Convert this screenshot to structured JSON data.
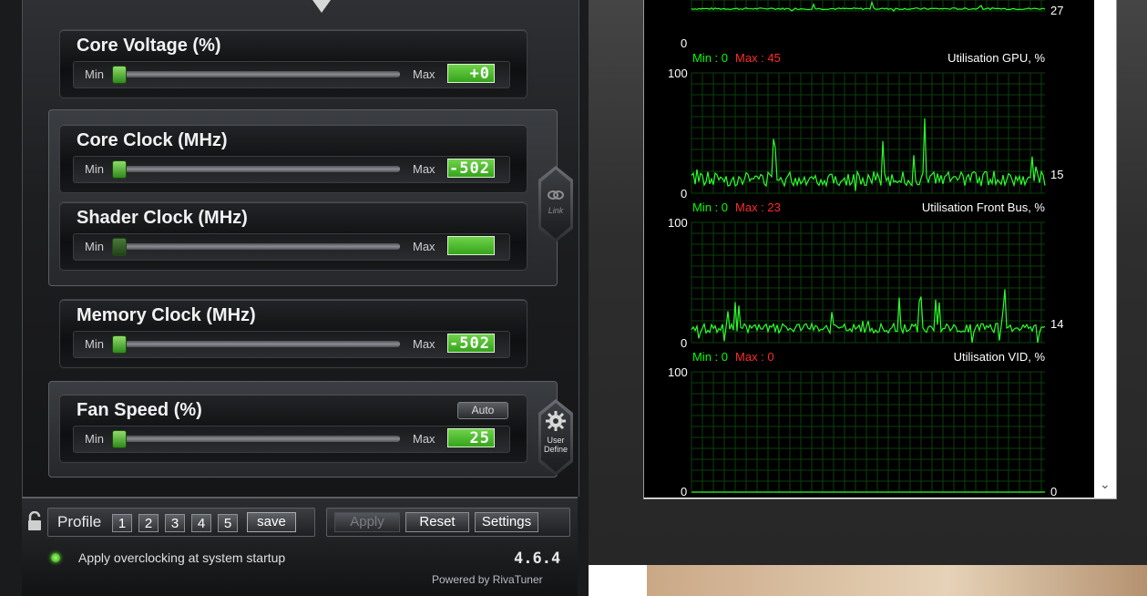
{
  "oc": {
    "core_voltage": {
      "title": "Core Voltage (%)",
      "min_label": "Min",
      "max_label": "Max",
      "value": "+0",
      "level": 0
    },
    "core_clock": {
      "title": "Core Clock (MHz)",
      "min_label": "Min",
      "max_label": "Max",
      "value": "-502",
      "level": 0
    },
    "shader_clock": {
      "title": "Shader Clock (MHz)",
      "min_label": "Min",
      "max_label": "Max",
      "value": "",
      "level": 0
    },
    "memory_clock": {
      "title": "Memory Clock (MHz)",
      "min_label": "Min",
      "max_label": "Max",
      "value": "-502",
      "level": 0
    },
    "fan_speed": {
      "title": "Fan Speed (%)",
      "min_label": "Min",
      "max_label": "Max",
      "value": "25",
      "level": 0,
      "auto_label": "Auto"
    },
    "link_label": "Link",
    "user_define_label_1": "User",
    "user_define_label_2": "Define"
  },
  "bottom": {
    "profile_label": "Profile",
    "profiles": [
      "1",
      "2",
      "3",
      "4",
      "5"
    ],
    "save_label": "save",
    "apply_label": "Apply",
    "reset_label": "Reset",
    "settings_label": "Settings",
    "startup_text": "Apply overclocking at startup",
    "startup_text_full": "Apply overclocking at system startup",
    "version": "4.6.4",
    "powered_by": "Powered by RivaTuner"
  },
  "monitor": {
    "graphs": [
      {
        "title": "",
        "max": "",
        "zero": "0",
        "current": "27",
        "min_label": "Min : 0",
        "max_label": "Max : 45"
      },
      {
        "title": "Utilisation GPU, %",
        "max": "100",
        "zero": "0",
        "current": "15",
        "min_label": "Min : 0",
        "max_label": "Max : 23"
      },
      {
        "title": "Utilisation Front Bus, %",
        "max": "100",
        "zero": "0",
        "current": "14",
        "min_label": "Min : 0",
        "max_label": "Max : 0"
      },
      {
        "title": "Utilisation VID, %",
        "max": "100",
        "zero": "0",
        "current": "0",
        "min_label": "",
        "max_label": ""
      }
    ]
  },
  "colors": {
    "accent_green": "#35a41b",
    "graph_line": "#2bff2b",
    "grid": "#0b3f0b",
    "max_red": "#ff2a2a"
  }
}
